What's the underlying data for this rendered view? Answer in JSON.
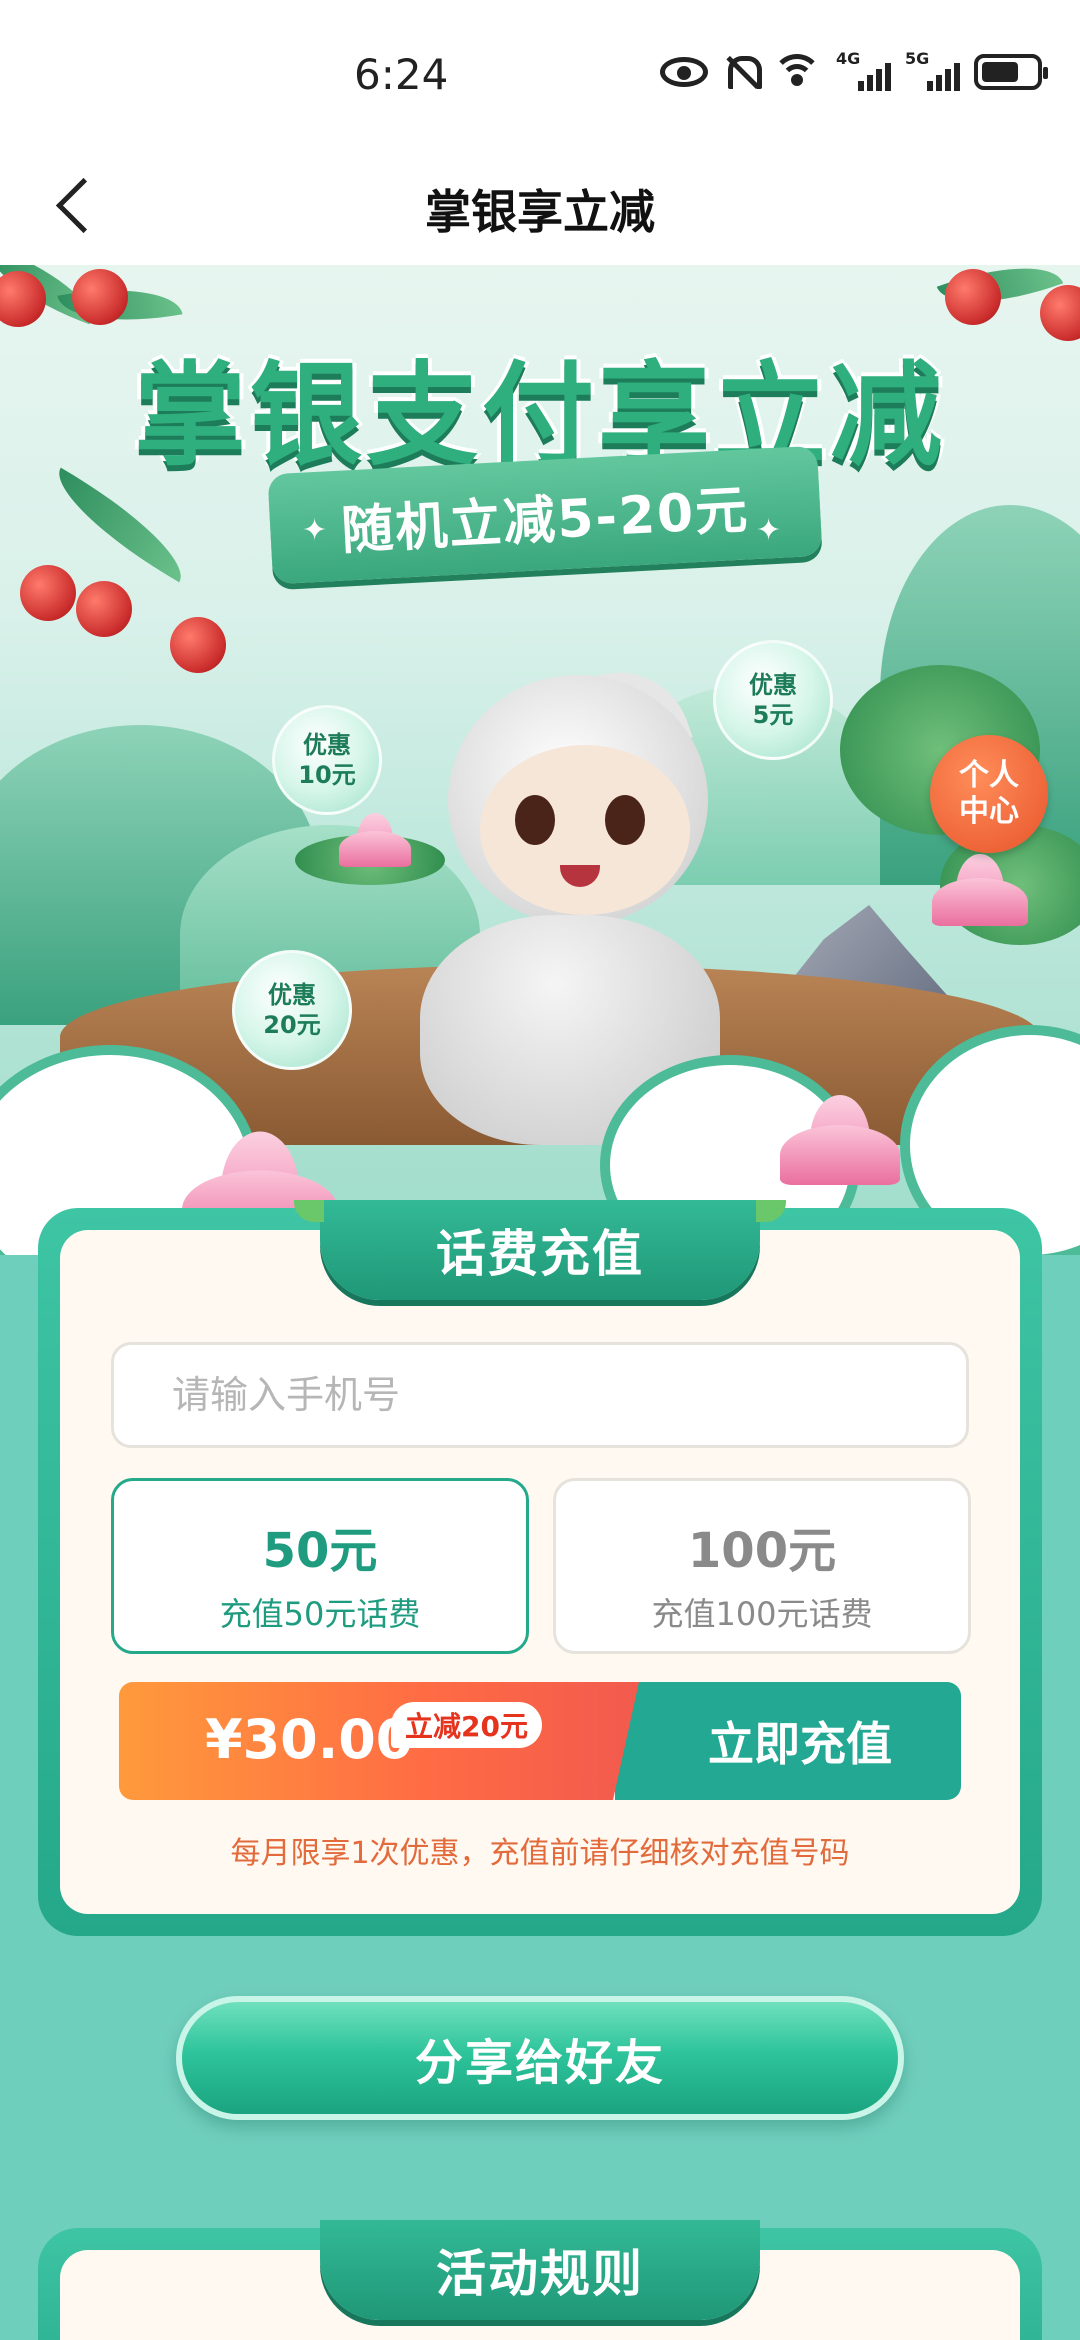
{
  "status_bar": {
    "time": "6:24",
    "icons": [
      "eye-icon",
      "bell-muted-icon",
      "wifi-icon",
      "signal-4g-icon",
      "signal-5g-icon",
      "battery-icon"
    ],
    "network_4g": "4G",
    "network_5g": "5G"
  },
  "header": {
    "title": "掌银享立减",
    "back_icon": "chevron-left-icon"
  },
  "hero": {
    "headline": "掌银支付享立减",
    "ribbon": "随机立减5-20元",
    "bubbles": {
      "b10": "优惠\n10元",
      "b5": "优惠\n5元",
      "b20": "优惠\n20元"
    },
    "personal_center": "个人\n中心"
  },
  "recharge": {
    "section_title": "话费充值",
    "phone_placeholder": "请输入手机号",
    "phone_value": "",
    "options": [
      {
        "amount": "50元",
        "desc": "充值50元话费",
        "selected": true
      },
      {
        "amount": "100元",
        "desc": "充值100元话费",
        "selected": false
      }
    ],
    "price": "¥30.00",
    "discount": "立减20元",
    "pay_button": "立即充值",
    "notice": "每月限享1次优惠，充值前请仔细核对充值号码"
  },
  "share": {
    "button": "分享给好友"
  },
  "rules": {
    "section_title": "活动规则"
  },
  "colors": {
    "brand_green": "#24a98a",
    "page_bg": "#6fcfbd",
    "price_orange": "#ff6b44",
    "notice_text": "#e26a3b"
  }
}
